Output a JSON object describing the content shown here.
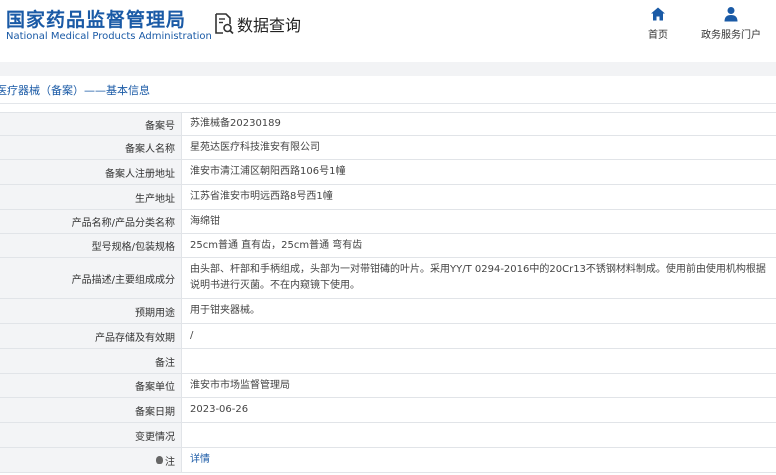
{
  "header": {
    "logo_cn": "国家药品监督管理局",
    "logo_en": "National Medical Products Administration",
    "query_label": "数据查询",
    "nav": [
      {
        "label": "首页",
        "icon": "home-icon"
      },
      {
        "label": "政务服务门户",
        "icon": "user-icon"
      }
    ]
  },
  "breadcrumb": "医疗器械（备案）——基本信息",
  "rows": [
    {
      "label": "备案号",
      "value": "苏淮械备20230189"
    },
    {
      "label": "备案人名称",
      "value": "星苑达医疗科技淮安有限公司"
    },
    {
      "label": "备案人注册地址",
      "value": "淮安市清江浦区朝阳西路106号1幢"
    },
    {
      "label": "生产地址",
      "value": "江苏省淮安市明远西路8号西1幢"
    },
    {
      "label": "产品名称/产品分类名称",
      "value": "海绵钳"
    },
    {
      "label": "型号规格/包装规格",
      "value": "25cm普通 直有齿，25cm普通 弯有齿"
    },
    {
      "label": "产品描述/主要组成成分",
      "value": "由头部、杆部和手柄组成，头部为一对带钳碡的叶片。采用YY/T 0294-2016中的20Cr13不锈钢材料制成。使用前由使用机构根据说明书进行灭菌。不在内窥镜下使用。"
    },
    {
      "label": "预期用途",
      "value": "用于钳夹器械。"
    },
    {
      "label": "产品存储及有效期",
      "value": "/"
    },
    {
      "label": "备注",
      "value": ""
    },
    {
      "label": "备案单位",
      "value": "淮安市市场监督管理局"
    },
    {
      "label": "备案日期",
      "value": "2023-06-26"
    },
    {
      "label": "变更情况",
      "value": ""
    },
    {
      "label": "注",
      "value": "详情",
      "link": true
    }
  ]
}
